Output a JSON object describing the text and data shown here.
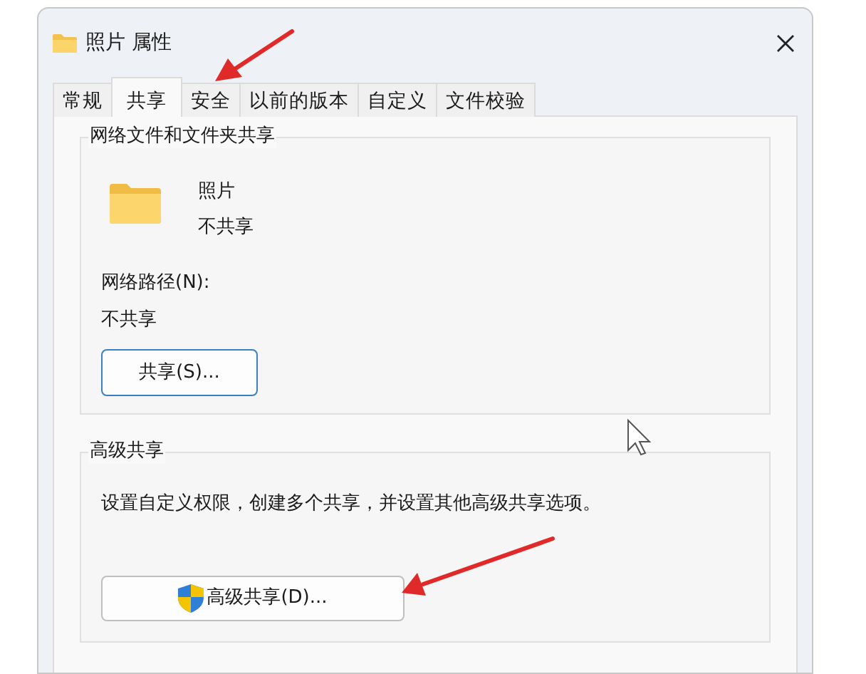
{
  "window": {
    "title": "照片 属性"
  },
  "tabs": [
    {
      "label": "常规",
      "selected": false
    },
    {
      "label": "共享",
      "selected": true
    },
    {
      "label": "安全",
      "selected": false
    },
    {
      "label": "以前的版本",
      "selected": false
    },
    {
      "label": "自定义",
      "selected": false
    },
    {
      "label": "文件校验",
      "selected": false
    }
  ],
  "network_sharing": {
    "legend": "网络文件和文件夹共享",
    "folder_name": "照片",
    "folder_status": "不共享",
    "path_label": "网络路径(N):",
    "path_value": "不共享",
    "button": "共享(S)..."
  },
  "advanced_sharing": {
    "legend": "高级共享",
    "description": "设置自定义权限，创建多个共享，并设置其他高级共享选项。",
    "button": "高级共享(D)..."
  }
}
